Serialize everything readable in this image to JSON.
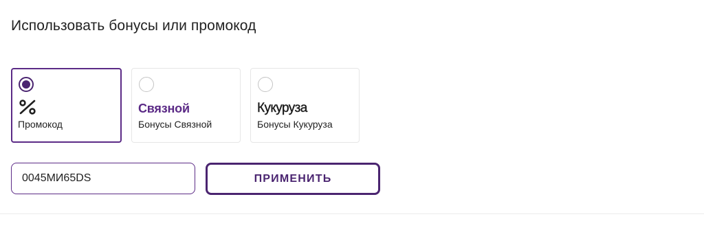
{
  "section": {
    "title": "Использовать бонусы или промокод"
  },
  "options": [
    {
      "id": "promo",
      "logo_text": "",
      "icon": "percent-icon",
      "label": "Промокод",
      "selected": true
    },
    {
      "id": "svyaznoy",
      "logo_text": "Связной",
      "label": "Бонусы Связной",
      "selected": false
    },
    {
      "id": "kukuruza",
      "logo_text": "Кукуруза",
      "label": "Бонусы Кукуруза",
      "selected": false
    }
  ],
  "promo_form": {
    "input_value": "0045МИ65DS",
    "apply_label": "ПРИМЕНИТЬ"
  },
  "colors": {
    "accent": "#4a2470",
    "brand_svyaznoy": "#5b2a86",
    "border": "#e6e6e6"
  }
}
